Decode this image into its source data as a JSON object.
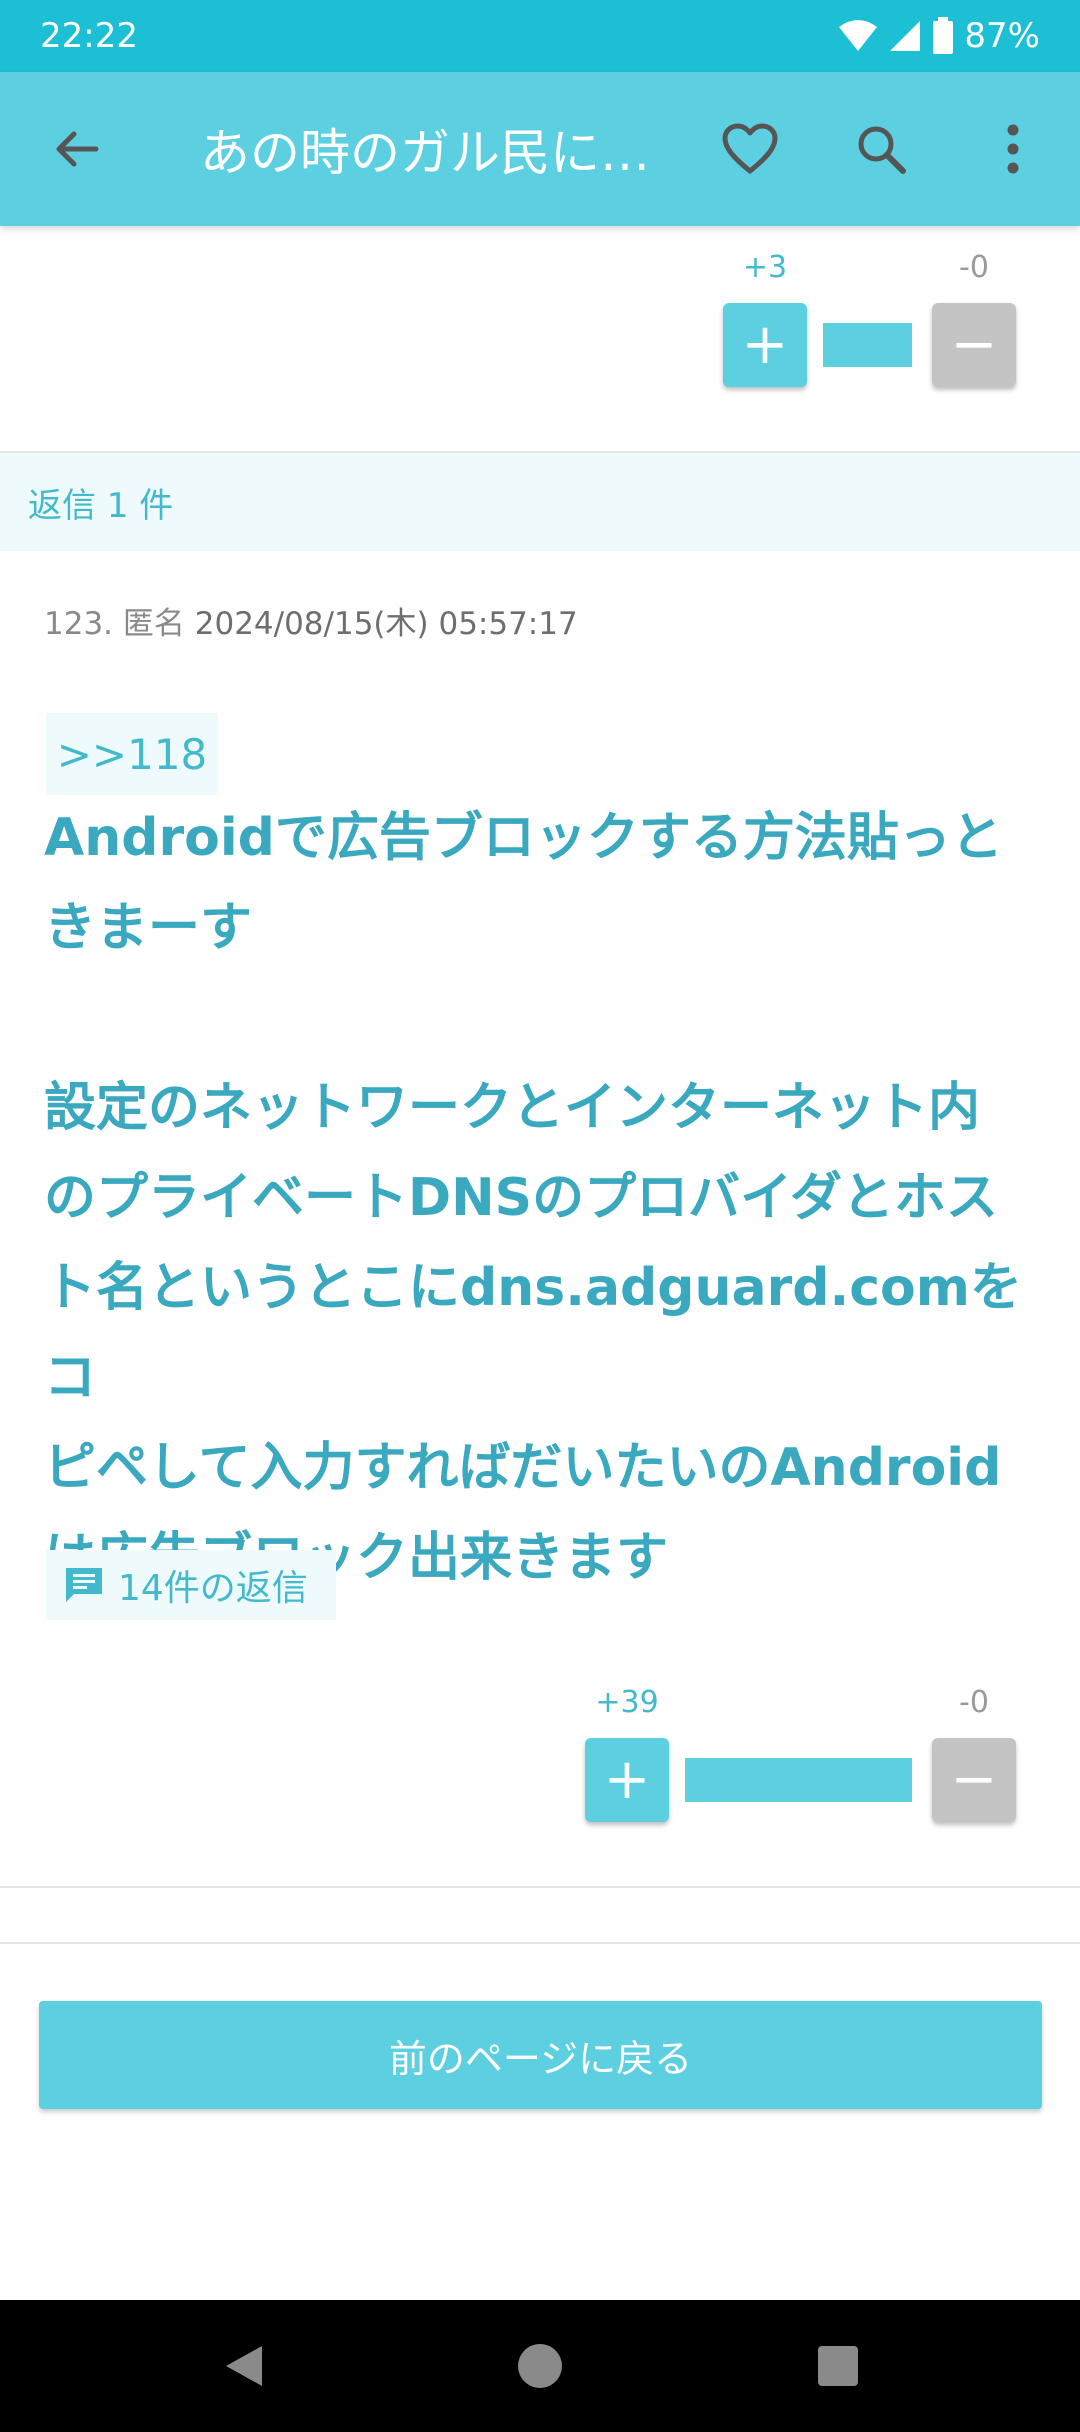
{
  "status_bar": {
    "time": "22:22",
    "battery": "87%"
  },
  "app_bar": {
    "title": "あの時のガル民に…",
    "icons": [
      "back-arrow-icon",
      "heart-icon",
      "search-icon",
      "more-vert-icon"
    ]
  },
  "previous_comment_votes": {
    "plus_count": "+3",
    "minus_count": "-0",
    "plus_label": "+",
    "minus_label": "−"
  },
  "reply_header": "返信 1 件",
  "comment": {
    "number": "123.",
    "author": "匿名",
    "date": "2024/08/15(木) 05:57:17",
    "anchor": ">>118",
    "body": "Androidで広告ブロックする方法貼っと\nきまーす\n\n設定のネットワークとインターネット内\nのプライベートDNSのプロバイダとホス\nト名というとこにdns.adguard.comをコ\nピペして入力すればだいたいのAndroid\nは広告ブロック出来きます",
    "reply_count": "14件の返信",
    "plus_count": "+39",
    "minus_count": "-0",
    "plus_label": "+",
    "minus_label": "−"
  },
  "back_button": "前のページに戻る",
  "colors": {
    "status_bar": "#1cbfd4",
    "app_bar": "#5ccfe0",
    "accent_text": "#3aa9bf",
    "minus_button": "#c4c4c4"
  }
}
